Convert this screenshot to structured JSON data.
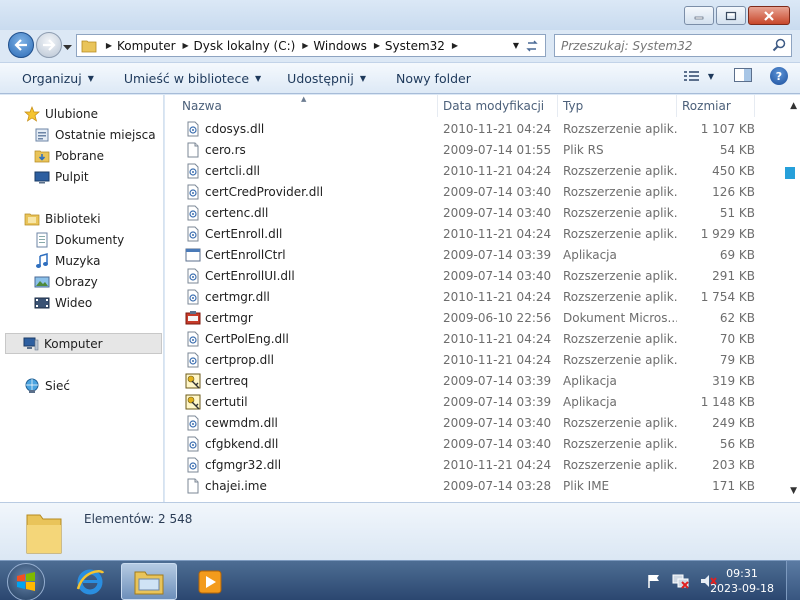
{
  "window": {
    "controls": {
      "minimize": "minimize",
      "maximize": "maximize",
      "close": "close"
    }
  },
  "address": {
    "crumbs": [
      "Komputer",
      "Dysk lokalny (C:)",
      "Windows",
      "System32"
    ],
    "search_placeholder": "Przeszukaj: System32"
  },
  "toolbar": {
    "organize": "Organizuj",
    "include_in_library": "Umieść w bibliotece",
    "share": "Udostępnij",
    "new_folder": "Nowy folder"
  },
  "nav": {
    "favorites": "Ulubione",
    "recent_places": "Ostatnie miejsca",
    "downloads": "Pobrane",
    "desktop": "Pulpit",
    "libraries": "Biblioteki",
    "documents": "Dokumenty",
    "music": "Muzyka",
    "pictures": "Obrazy",
    "videos": "Wideo",
    "computer": "Komputer",
    "network": "Sieć"
  },
  "columns": {
    "name": "Nazwa",
    "modified": "Data modyfikacji",
    "type": "Typ",
    "size": "Rozmiar"
  },
  "files": [
    {
      "name": "cdosys.dll",
      "date": "2010-11-21 04:24",
      "type": "Rozszerzenie aplik...",
      "size": "1 107 KB",
      "icon": "dll-icon"
    },
    {
      "name": "cero.rs",
      "date": "2009-07-14 01:55",
      "type": "Plik RS",
      "size": "54 KB",
      "icon": "file-icon"
    },
    {
      "name": "certcli.dll",
      "date": "2010-11-21 04:24",
      "type": "Rozszerzenie aplik...",
      "size": "450 KB",
      "icon": "dll-icon"
    },
    {
      "name": "certCredProvider.dll",
      "date": "2009-07-14 03:40",
      "type": "Rozszerzenie aplik...",
      "size": "126 KB",
      "icon": "dll-icon"
    },
    {
      "name": "certenc.dll",
      "date": "2009-07-14 03:40",
      "type": "Rozszerzenie aplik...",
      "size": "51 KB",
      "icon": "dll-icon"
    },
    {
      "name": "CertEnroll.dll",
      "date": "2010-11-21 04:24",
      "type": "Rozszerzenie aplik...",
      "size": "1 929 KB",
      "icon": "dll-icon"
    },
    {
      "name": "CertEnrollCtrl",
      "date": "2009-07-14 03:39",
      "type": "Aplikacja",
      "size": "69 KB",
      "icon": "app-icon"
    },
    {
      "name": "CertEnrollUI.dll",
      "date": "2009-07-14 03:40",
      "type": "Rozszerzenie aplik...",
      "size": "291 KB",
      "icon": "dll-icon"
    },
    {
      "name": "certmgr.dll",
      "date": "2010-11-21 04:24",
      "type": "Rozszerzenie aplik...",
      "size": "1 754 KB",
      "icon": "dll-icon"
    },
    {
      "name": "certmgr",
      "date": "2009-06-10 22:56",
      "type": "Dokument Micros...",
      "size": "62 KB",
      "icon": "msc-icon"
    },
    {
      "name": "CertPolEng.dll",
      "date": "2010-11-21 04:24",
      "type": "Rozszerzenie aplik...",
      "size": "70 KB",
      "icon": "dll-icon"
    },
    {
      "name": "certprop.dll",
      "date": "2010-11-21 04:24",
      "type": "Rozszerzenie aplik...",
      "size": "79 KB",
      "icon": "dll-icon"
    },
    {
      "name": "certreq",
      "date": "2009-07-14 03:39",
      "type": "Aplikacja",
      "size": "319 KB",
      "icon": "cert-app-icon"
    },
    {
      "name": "certutil",
      "date": "2009-07-14 03:39",
      "type": "Aplikacja",
      "size": "1 148 KB",
      "icon": "cert-app-icon"
    },
    {
      "name": "cewmdm.dll",
      "date": "2009-07-14 03:40",
      "type": "Rozszerzenie aplik...",
      "size": "249 KB",
      "icon": "dll-icon"
    },
    {
      "name": "cfgbkend.dll",
      "date": "2009-07-14 03:40",
      "type": "Rozszerzenie aplik...",
      "size": "56 KB",
      "icon": "dll-icon"
    },
    {
      "name": "cfgmgr32.dll",
      "date": "2010-11-21 04:24",
      "type": "Rozszerzenie aplik...",
      "size": "203 KB",
      "icon": "dll-icon"
    },
    {
      "name": "chajei.ime",
      "date": "2009-07-14 03:28",
      "type": "Plik IME",
      "size": "171 KB",
      "icon": "file-icon"
    }
  ],
  "details": {
    "count": "Elementów: 2 548"
  },
  "taskbar": {
    "time": "09:31",
    "date": "2023-09-18"
  }
}
